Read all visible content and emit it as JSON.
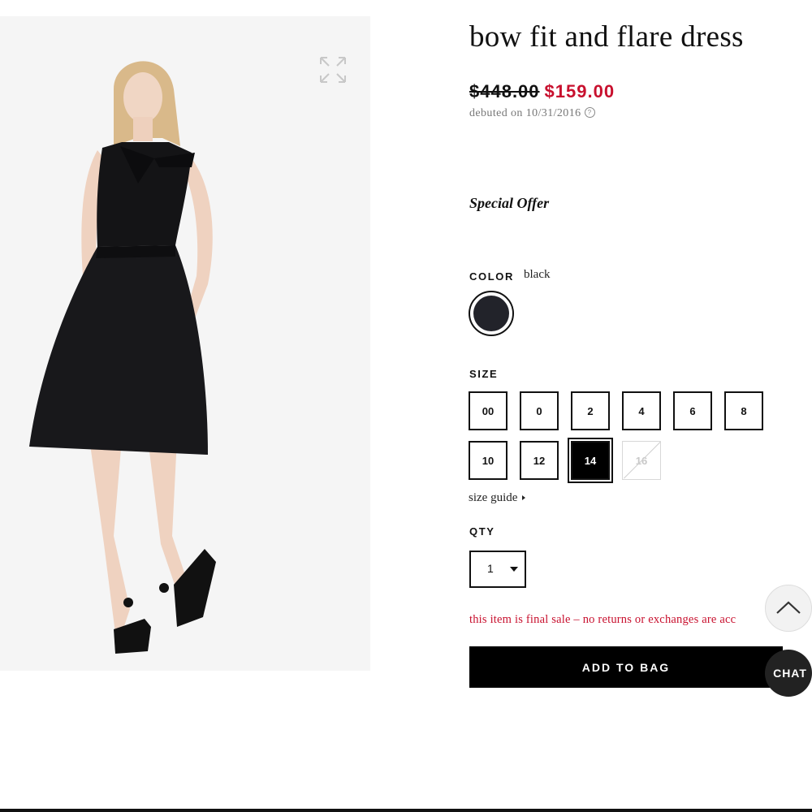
{
  "product": {
    "title": "bow fit and flare dress",
    "price_original": "$448.00",
    "price_sale": "$159.00",
    "debut": "debuted on 10/31/2016",
    "info_icon_glyph": "?",
    "special_offer": "Special Offer"
  },
  "color": {
    "label": "COLOR",
    "selected": "black",
    "swatch_hex": "#22232a"
  },
  "size": {
    "label": "SIZE",
    "options": [
      "00",
      "0",
      "2",
      "4",
      "6",
      "8",
      "10",
      "12",
      "14",
      "16"
    ],
    "selected": "14",
    "unavailable": [
      "16"
    ],
    "guide_label": "size guide"
  },
  "qty": {
    "label": "QTY",
    "value": "1"
  },
  "notice": {
    "final_sale": "this item is final sale – no returns or exchanges are acc"
  },
  "actions": {
    "add_to_bag": "ADD TO BAG",
    "chat": "CHAT"
  },
  "icons": {
    "expand": "expand-arrows-icon",
    "scroll_top": "chevron-up-icon",
    "info": "info-circle-icon"
  },
  "colors": {
    "sale_red": "#c8102e",
    "button_black": "#000000"
  }
}
